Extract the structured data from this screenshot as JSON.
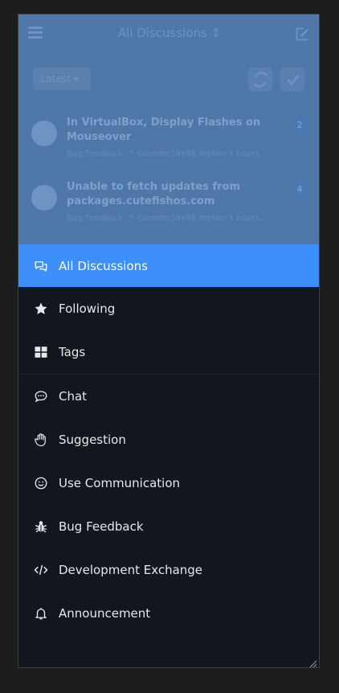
{
  "background": {
    "title": "All Discussions",
    "sort_label": "Latest",
    "discussions": [
      {
        "title": "In VirtualBox, Display Flashes on Mouseover",
        "tag": "Bug Feedback",
        "meta": "Grender5949$ replied 4 hours",
        "count": "2"
      },
      {
        "title": "Unable to fetch updates from packages.cutefishos.com",
        "tag": "Bug Feedback",
        "meta": "Grender5949$ replied 4 hours...",
        "count": "4"
      }
    ]
  },
  "drawer": {
    "items": [
      {
        "label": "All Discussions",
        "icon": "chat-bubbles-icon",
        "active": true
      },
      {
        "label": "Following",
        "icon": "star-icon"
      },
      {
        "label": "Tags",
        "icon": "grid-icon"
      },
      {
        "label": "Chat",
        "icon": "comment-dots-icon"
      },
      {
        "label": "Suggestion",
        "icon": "hand-icon"
      },
      {
        "label": "Use Communication",
        "icon": "smile-icon"
      },
      {
        "label": "Bug Feedback",
        "icon": "bug-icon"
      },
      {
        "label": "Development Exchange",
        "icon": "code-icon"
      },
      {
        "label": "Announcement",
        "icon": "bell-icon"
      }
    ]
  },
  "colors": {
    "accent": "#3d8ffb",
    "drawer_bg": "#12171d",
    "overlay": "#4f77a8"
  }
}
